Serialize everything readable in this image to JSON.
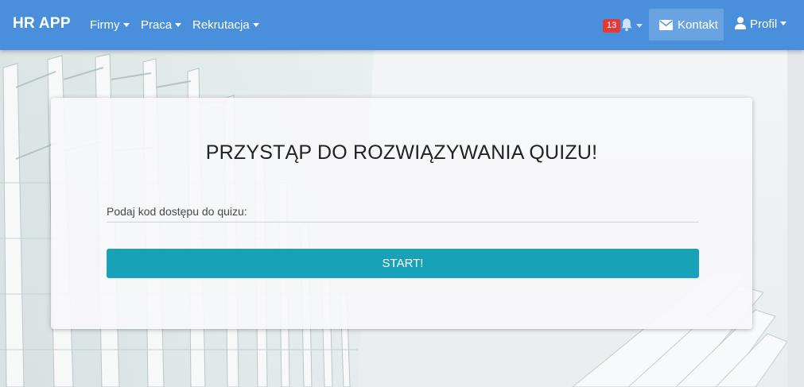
{
  "navbar": {
    "brand": "HR APP",
    "menus": [
      {
        "label": "Firmy"
      },
      {
        "label": "Praca"
      },
      {
        "label": "Rekrutacja"
      }
    ],
    "notifications": {
      "count": "13",
      "icon": "bell-icon"
    },
    "contact": {
      "label": "Kontakt",
      "icon": "envelope-icon"
    },
    "profile": {
      "label": "Profil",
      "icon": "user-icon"
    }
  },
  "quiz": {
    "title": "PRZYSTĄP DO ROZWIĄZYWANIA QUIZU!",
    "code_field": {
      "placeholder": "Podaj kod dostępu do quizu:",
      "value": ""
    },
    "start_button": "START!"
  },
  "colors": {
    "navbar": "#4a8fdc",
    "start_button": "#17a2b8",
    "badge": "#e53935"
  }
}
